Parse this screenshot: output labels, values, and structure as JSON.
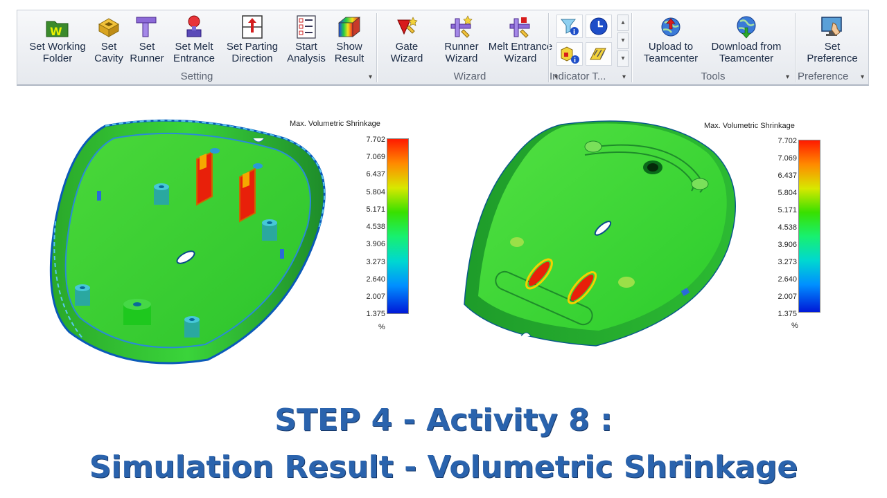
{
  "ribbon": {
    "groups": {
      "setting": {
        "label": "Setting",
        "buttons": [
          {
            "label": "Set Working\nFolder"
          },
          {
            "label": "Set\nCavity"
          },
          {
            "label": "Set\nRunner"
          },
          {
            "label": "Set Melt\nEntrance"
          },
          {
            "label": "Set Parting\nDirection"
          },
          {
            "label": "Start\nAnalysis"
          },
          {
            "label": "Show\nResult"
          }
        ]
      },
      "wizard": {
        "label": "Wizard",
        "buttons": [
          {
            "label": "Gate\nWizard"
          },
          {
            "label": "Runner\nWizard"
          },
          {
            "label": "Melt Entrance\nWizard"
          }
        ]
      },
      "indicator": {
        "label": "Indicator T..."
      },
      "tools": {
        "label": "Tools",
        "buttons": [
          {
            "label": "Upload to\nTeamcenter"
          },
          {
            "label": "Download from\nTeamcenter"
          }
        ]
      },
      "preference": {
        "label": "Preference",
        "buttons": [
          {
            "label": "Set\nPreference"
          }
        ]
      }
    }
  },
  "results": {
    "left": {
      "legend_title": "Max. Volumetric Shrinkage",
      "ticks": [
        "7.702",
        "7.069",
        "6.437",
        "5.804",
        "5.171",
        "4.538",
        "3.906",
        "3.273",
        "2.640",
        "2.007",
        "1.375"
      ],
      "unit": "%"
    },
    "right": {
      "legend_title": "Max. Volumetric Shrinkage",
      "ticks": [
        "7.702",
        "7.069",
        "6.437",
        "5.804",
        "5.171",
        "4.538",
        "3.906",
        "3.273",
        "2.640",
        "2.007",
        "1.375"
      ],
      "unit": "%"
    }
  },
  "caption": {
    "line1": "STEP 4 - Activity 8 :",
    "line2": "Simulation Result - Volumetric Shrinkage"
  },
  "colors": {
    "title_blue": "#2a63ad",
    "part_green": "#3ad43a",
    "hot_red": "#e8200a"
  }
}
